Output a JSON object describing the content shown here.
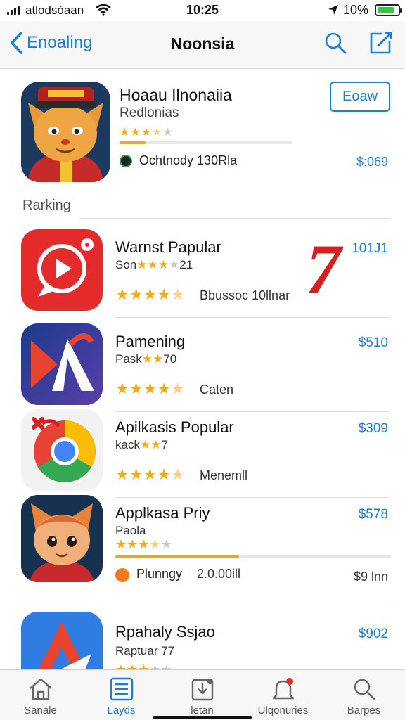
{
  "status": {
    "carrier": "atlodsòaan",
    "time": "10:25",
    "battery": "10%",
    "battery_level": 0.85
  },
  "nav": {
    "back_label": "Enoaling",
    "title": "Noonsia"
  },
  "featured": {
    "name": "Hoaau Ilnonaiia",
    "subtitle": "Redlonias",
    "stars": 3.5,
    "progress": 0.15,
    "developer": "Ochtnody 130Rla",
    "button": "Eoaw",
    "price": "$:069"
  },
  "section": {
    "label": "Rarking"
  },
  "badge": "7",
  "rows": [
    {
      "name": "Warnst Papular",
      "sub": "Son",
      "sub_stars": "★★★",
      "sub_tail": "21",
      "stars": 4.5,
      "extra": "Bbussoc 10llnar",
      "price": "101J1"
    },
    {
      "name": "Pamening",
      "sub": "Pask",
      "sub_stars": "★★",
      "sub_tail": "70",
      "stars": 4.5,
      "extra": "Caten",
      "price": "$510"
    },
    {
      "name": "Apilkasis Popular",
      "sub": "kack",
      "sub_stars": "★★",
      "sub_tail": "7",
      "stars": 4.5,
      "extra": "Menemll",
      "price": "$309"
    },
    {
      "name": "Applkasa Priy",
      "sub": "Paola",
      "stars": 3.5,
      "progress": 0.45,
      "developer": "Plunngy",
      "size": "2.0.00ill",
      "price": "$578",
      "price2": "$9 lnn"
    },
    {
      "name": "Rpahaly Ssjao",
      "sub": "Raptuar 77",
      "stars": 3,
      "price": "$902"
    }
  ],
  "tabs": [
    {
      "label": "Sanale",
      "icon": "home-icon"
    },
    {
      "label": "Layds",
      "icon": "list-icon",
      "active": true
    },
    {
      "label": "letan",
      "icon": "download-icon"
    },
    {
      "label": "Ulqonuries",
      "icon": "bell-icon"
    },
    {
      "label": "Barpes",
      "icon": "search-icon"
    }
  ]
}
